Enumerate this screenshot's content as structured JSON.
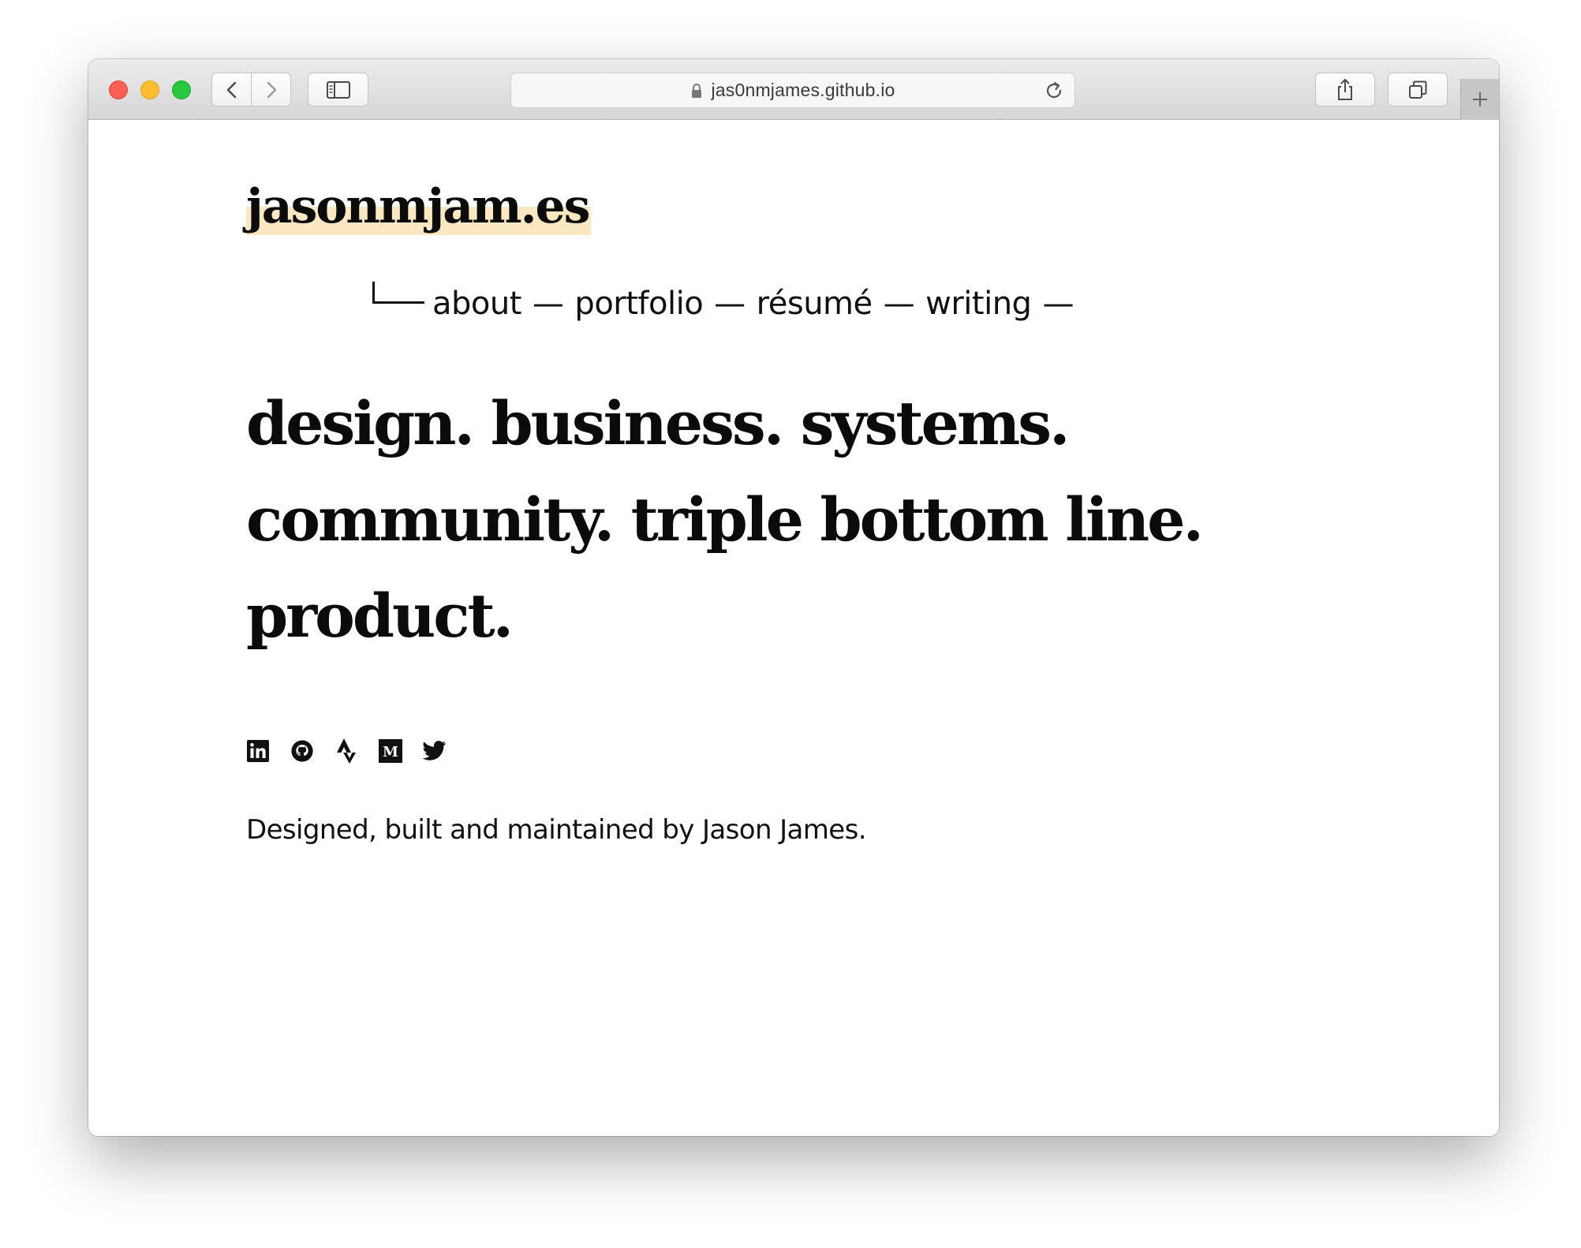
{
  "browser": {
    "url": "jas0nmjames.github.io",
    "icons": {
      "back": "chevron-left-icon",
      "forward": "chevron-right-icon",
      "sidebar": "sidebar-icon",
      "lock": "lock-icon",
      "reload": "reload-icon",
      "share": "share-icon",
      "tabs": "tabs-overview-icon",
      "new_tab": "plus-icon"
    }
  },
  "site": {
    "title": "jasonmjam.es",
    "title_highlight_color": "#fbe7c2",
    "nav": {
      "items": [
        {
          "label": "about"
        },
        {
          "label": "portfolio"
        },
        {
          "label": "résumé"
        },
        {
          "label": "writing"
        }
      ],
      "separator": "—"
    },
    "headline": {
      "lines": [
        "design. business. systems.",
        "community. triple bottom line.",
        "product."
      ]
    },
    "social": [
      {
        "name": "linkedin-icon"
      },
      {
        "name": "github-icon"
      },
      {
        "name": "strava-icon"
      },
      {
        "name": "medium-icon"
      },
      {
        "name": "twitter-icon"
      }
    ],
    "footer": "Designed, built and maintained by Jason James."
  }
}
